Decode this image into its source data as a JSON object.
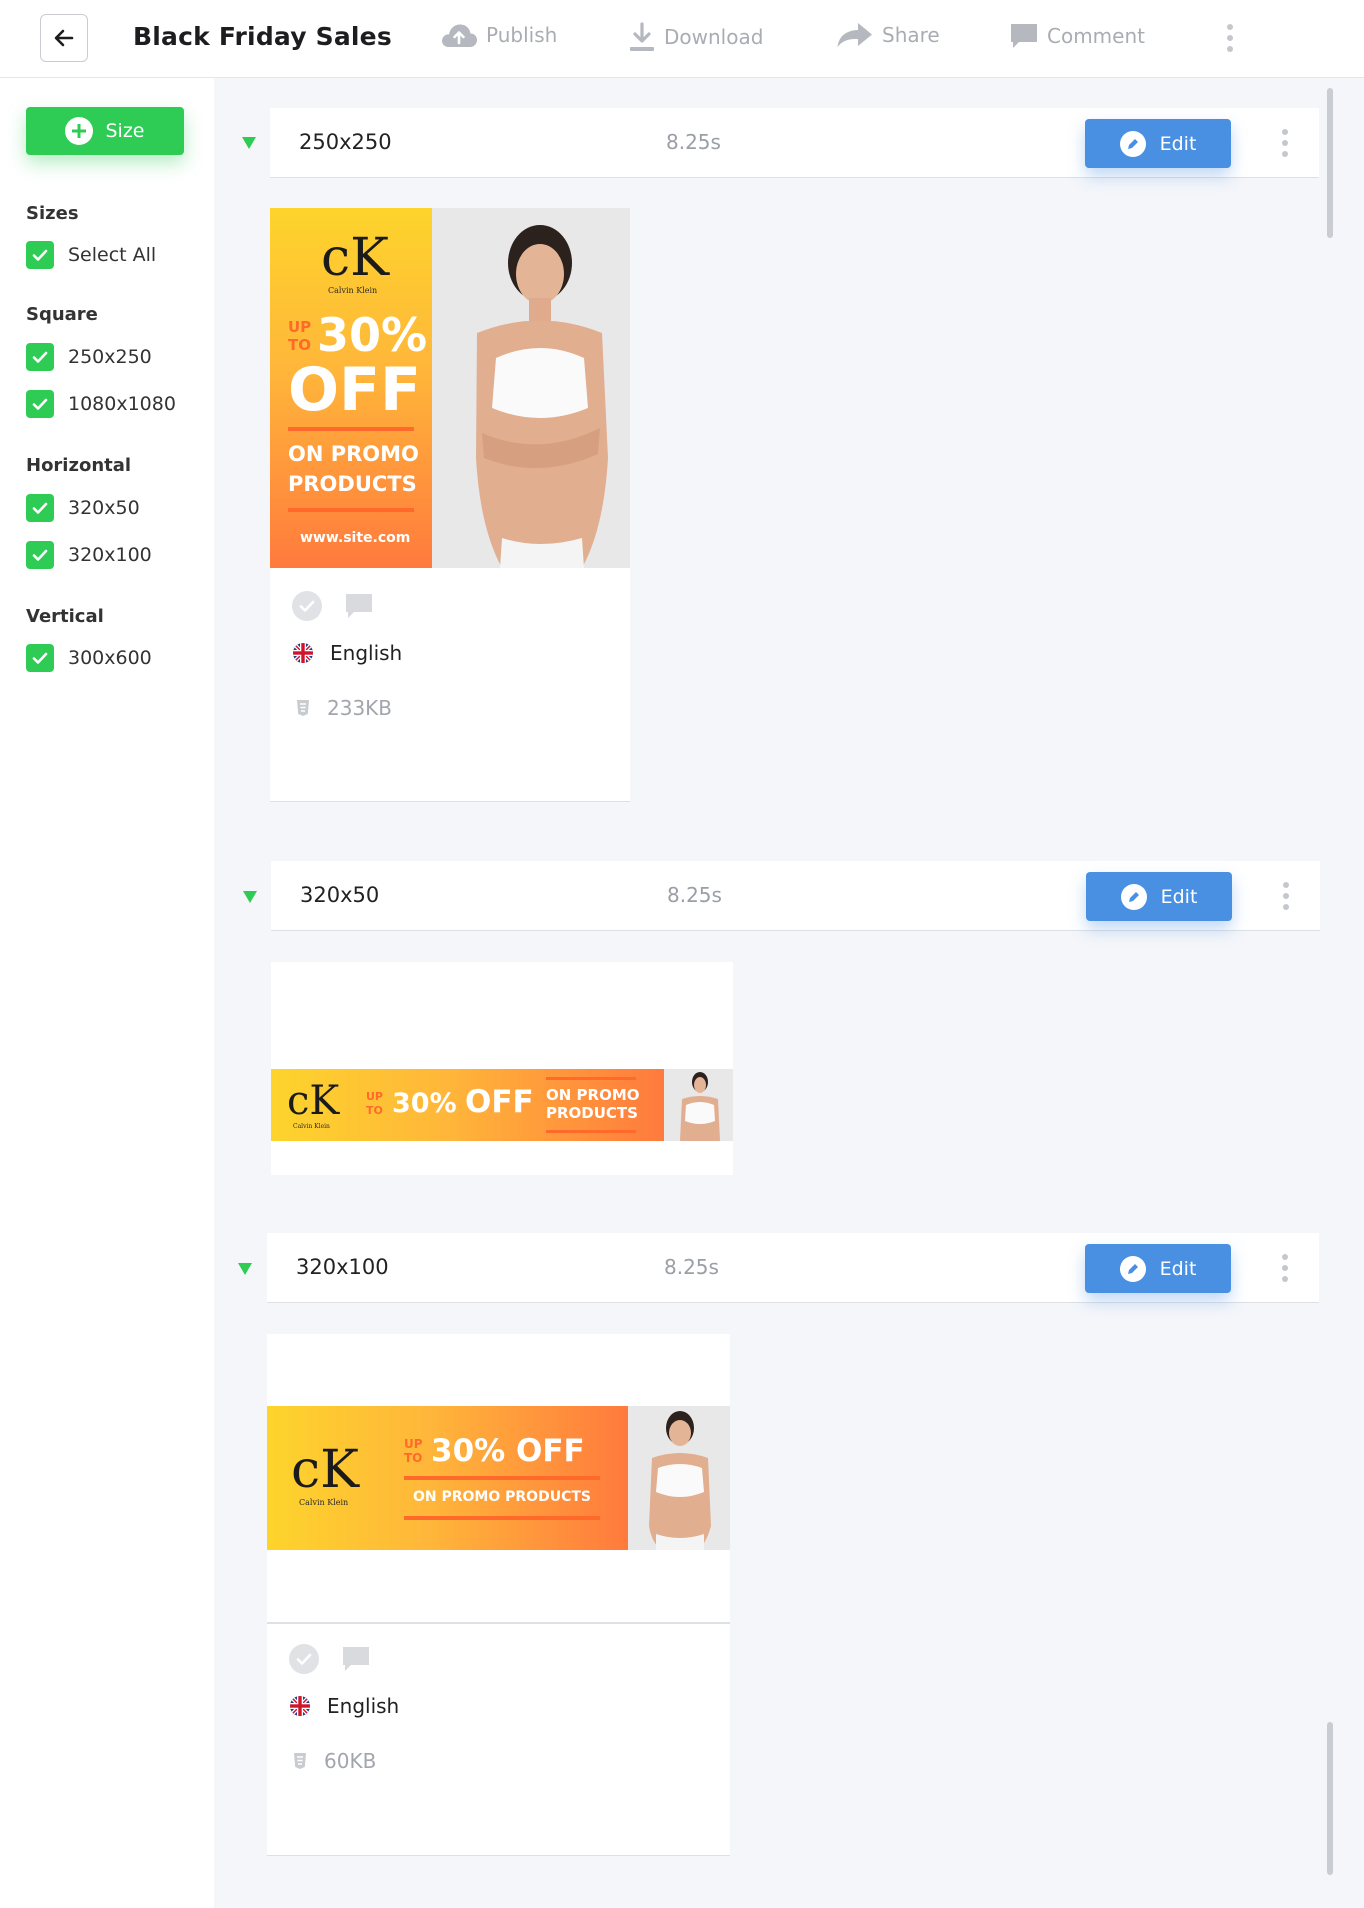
{
  "header": {
    "title": "Black Friday Sales",
    "actions": {
      "publish": "Publish",
      "download": "Download",
      "share": "Share",
      "comment": "Comment"
    }
  },
  "sidebar": {
    "add_size_label": "Size",
    "groups": {
      "sizes": {
        "title": "Sizes",
        "items": [
          "Select All"
        ]
      },
      "square": {
        "title": "Square",
        "items": [
          "250x250",
          "1080x1080"
        ]
      },
      "horizontal": {
        "title": "Horizontal",
        "items": [
          "320x50",
          "320x100"
        ]
      },
      "vertical": {
        "title": "Vertical",
        "items": [
          "300x600"
        ]
      }
    },
    "all_checked": true
  },
  "sections": [
    {
      "name": "250x250",
      "duration": "8.25s",
      "edit_label": "Edit",
      "language": "English",
      "file_size": "233KB"
    },
    {
      "name": "320x50",
      "duration": "8.25s",
      "edit_label": "Edit"
    },
    {
      "name": "320x100",
      "duration": "8.25s",
      "edit_label": "Edit",
      "language": "English",
      "file_size": "60KB"
    }
  ],
  "creative": {
    "brand": "cK",
    "brand_sub": "Calvin Klein",
    "up": "UP",
    "to": "TO",
    "discount": "30%",
    "off": "OFF",
    "discount_line": "30% OFF",
    "promo_line1": "ON PROMO",
    "promo_line2": "PRODUCTS",
    "promo_full": "ON PROMO PRODUCTS",
    "site": "www.site.com"
  },
  "colors": {
    "green": "#2fcc55",
    "blue": "#4a90e2",
    "orange": "#ff6a2b",
    "yellow": "#fdd42c"
  }
}
